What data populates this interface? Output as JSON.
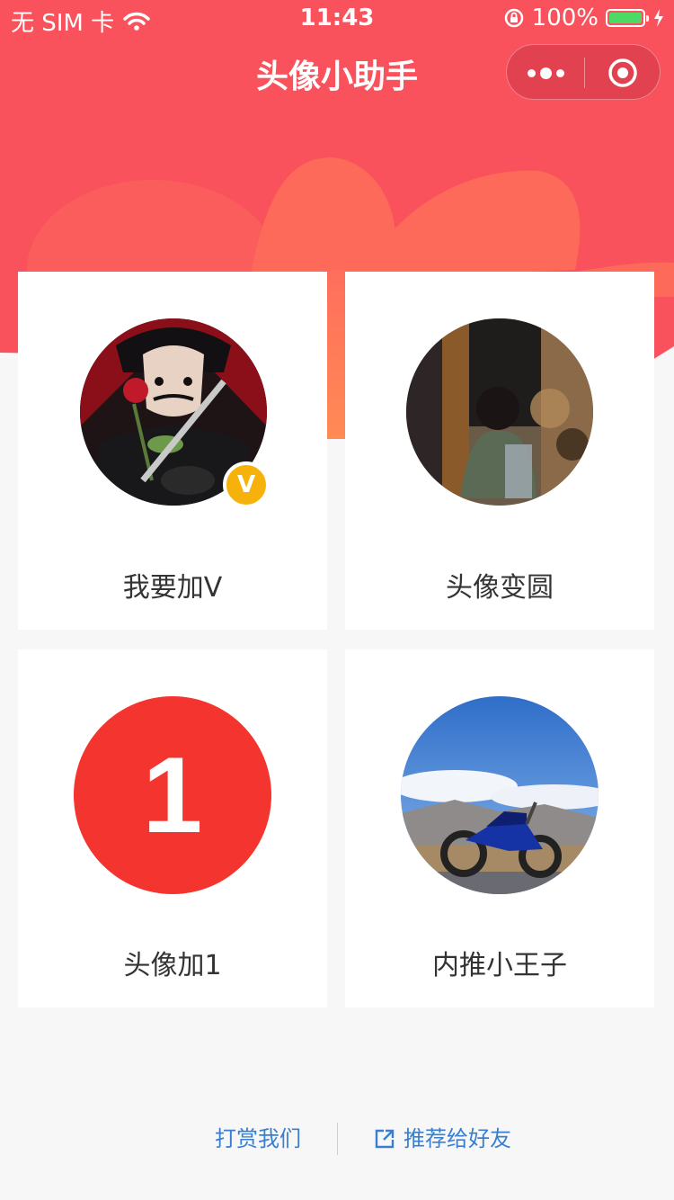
{
  "status_bar": {
    "carrier": "无 SIM 卡",
    "time": "11:43",
    "battery": "100%"
  },
  "nav": {
    "title": "头像小助手"
  },
  "colors": {
    "brand": "#f9525c",
    "petal": "#ff7a5c",
    "link": "#3a7fcf",
    "badge": "#f6b20b",
    "number_avatar": "#f3342f"
  },
  "cards": [
    {
      "label": "我要加V",
      "badge": "V"
    },
    {
      "label": "头像变圆"
    },
    {
      "label": "头像加1",
      "number": "1"
    },
    {
      "label": "内推小王子"
    }
  ],
  "footer": {
    "reward": "打赏我们",
    "share": "推荐给好友"
  }
}
